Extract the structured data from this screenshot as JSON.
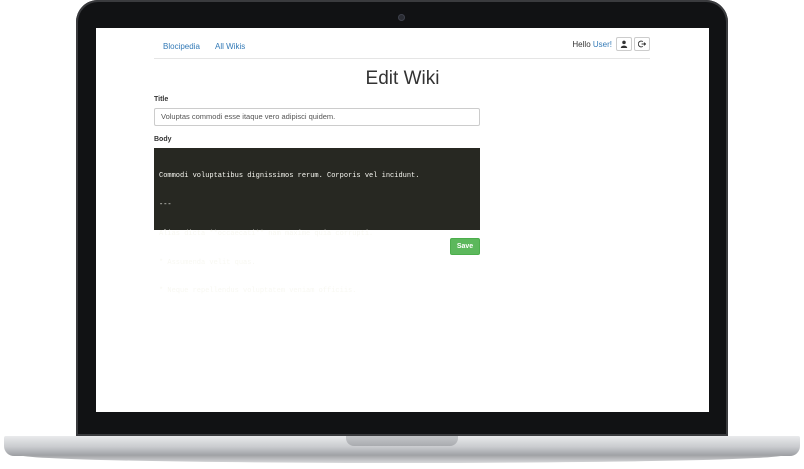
{
  "navbar": {
    "links": [
      {
        "label": "Blocipedia"
      },
      {
        "label": "All Wikis"
      }
    ],
    "greeting": "Hello",
    "user_link": "User!",
    "profile_icon": "user-icon",
    "logout_icon": "logout-icon"
  },
  "page": {
    "heading": "Edit Wiki"
  },
  "form": {
    "title_label": "Title",
    "title_value": "Voluptas commodi esse itaque vero adipisci quidem.",
    "body_label": "Body",
    "body_lines": [
      "Commodi voluptatibus dignissimos rerum. Corporis vel incidunt.",
      "---",
      "Alias dicta **occaecati** nam maxime quia corrupti.",
      "* Assumenda velit quas.",
      "* Neque repellendus voluptatem veniam officiis."
    ],
    "save_label": "Save"
  },
  "colors": {
    "link": "#337ab7",
    "editor_bg": "#272822",
    "save_button": "#5cb85c"
  }
}
